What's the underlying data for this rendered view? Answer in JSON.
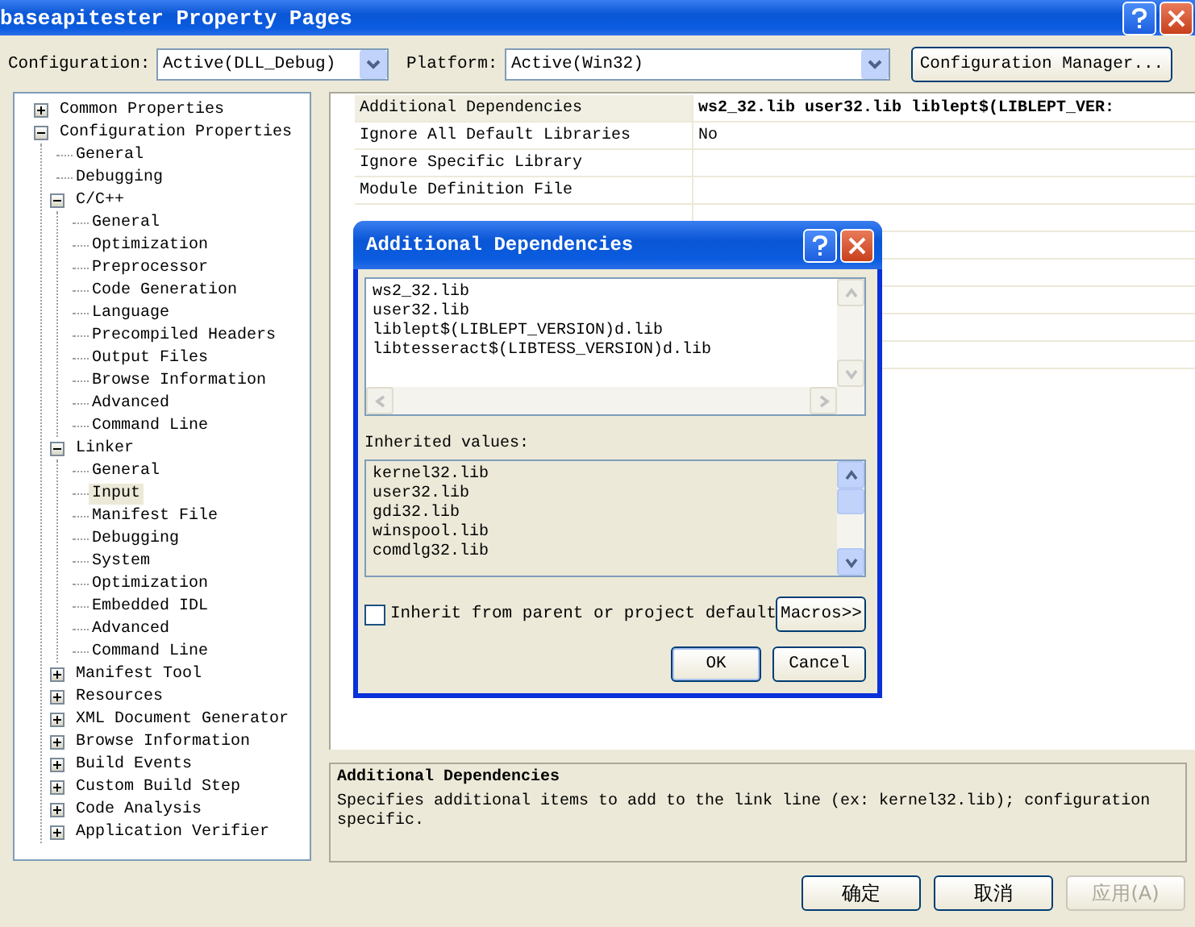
{
  "window": {
    "title": "baseapitester Property Pages"
  },
  "configuration": {
    "label": "Configuration:",
    "value": "Active(DLL_Debug)"
  },
  "platform": {
    "label": "Platform:",
    "value": "Active(Win32)"
  },
  "config_manager_button": "Configuration Manager...",
  "tree": [
    {
      "label": "Common Properties",
      "expanded": false,
      "selected": false
    },
    {
      "label": "Configuration Properties",
      "expanded": true,
      "selected": false,
      "children": [
        {
          "label": "General",
          "selected": false
        },
        {
          "label": "Debugging",
          "selected": false
        },
        {
          "label": "C/C++",
          "expanded": true,
          "selected": false,
          "children": [
            {
              "label": "General",
              "selected": false
            },
            {
              "label": "Optimization",
              "selected": false
            },
            {
              "label": "Preprocessor",
              "selected": false
            },
            {
              "label": "Code Generation",
              "selected": false
            },
            {
              "label": "Language",
              "selected": false
            },
            {
              "label": "Precompiled Headers",
              "selected": false
            },
            {
              "label": "Output Files",
              "selected": false
            },
            {
              "label": "Browse Information",
              "selected": false
            },
            {
              "label": "Advanced",
              "selected": false
            },
            {
              "label": "Command Line",
              "selected": false
            }
          ]
        },
        {
          "label": "Linker",
          "expanded": true,
          "selected": false,
          "children": [
            {
              "label": "General",
              "selected": false
            },
            {
              "label": "Input",
              "selected": true
            },
            {
              "label": "Manifest File",
              "selected": false
            },
            {
              "label": "Debugging",
              "selected": false
            },
            {
              "label": "System",
              "selected": false
            },
            {
              "label": "Optimization",
              "selected": false
            },
            {
              "label": "Embedded IDL",
              "selected": false
            },
            {
              "label": "Advanced",
              "selected": false
            },
            {
              "label": "Command Line",
              "selected": false
            }
          ]
        },
        {
          "label": "Manifest Tool",
          "expanded": false,
          "selected": false
        },
        {
          "label": "Resources",
          "expanded": false,
          "selected": false
        },
        {
          "label": "XML Document Generator",
          "expanded": false,
          "selected": false
        },
        {
          "label": "Browse Information",
          "expanded": false,
          "selected": false
        },
        {
          "label": "Build Events",
          "expanded": false,
          "selected": false
        },
        {
          "label": "Custom Build Step",
          "expanded": false,
          "selected": false
        },
        {
          "label": "Code Analysis",
          "expanded": false,
          "selected": false
        },
        {
          "label": "Application Verifier",
          "expanded": false,
          "selected": false
        }
      ]
    }
  ],
  "property_grid": [
    {
      "name": "Additional Dependencies",
      "value": "ws2_32.lib user32.lib liblept$(LIBLEPT_VER:",
      "selected": true
    },
    {
      "name": "Ignore All Default Libraries",
      "value": "No",
      "selected": false
    },
    {
      "name": "Ignore Specific Library",
      "selected": false
    },
    {
      "name": "Module Definition File",
      "selected": false
    }
  ],
  "description": {
    "title": "Additional Dependencies",
    "text": "Specifies additional items to add to the link line (ex: kernel32.lib); configuration specific."
  },
  "buttons": [
    {
      "label": "确定",
      "disabled": false
    },
    {
      "label": "取消",
      "disabled": false
    },
    {
      "label": "应用(A)",
      "disabled": true
    }
  ],
  "dialog": {
    "title": "Additional Dependencies",
    "entries": [
      "ws2_32.lib",
      "user32.lib",
      "liblept$(LIBLEPT_VERSION)d.lib",
      "libtesseract$(LIBTESS_VERSION)d.lib"
    ],
    "inherited_label": "Inherited values:",
    "inherited": [
      "kernel32.lib",
      "user32.lib",
      "gdi32.lib",
      "winspool.lib",
      "comdlg32.lib"
    ],
    "inherit_checkbox": {
      "label": "Inherit from parent or project default",
      "checked": false
    },
    "macros_button": "Macros>>",
    "ok_button": "OK",
    "cancel_button": "Cancel"
  }
}
